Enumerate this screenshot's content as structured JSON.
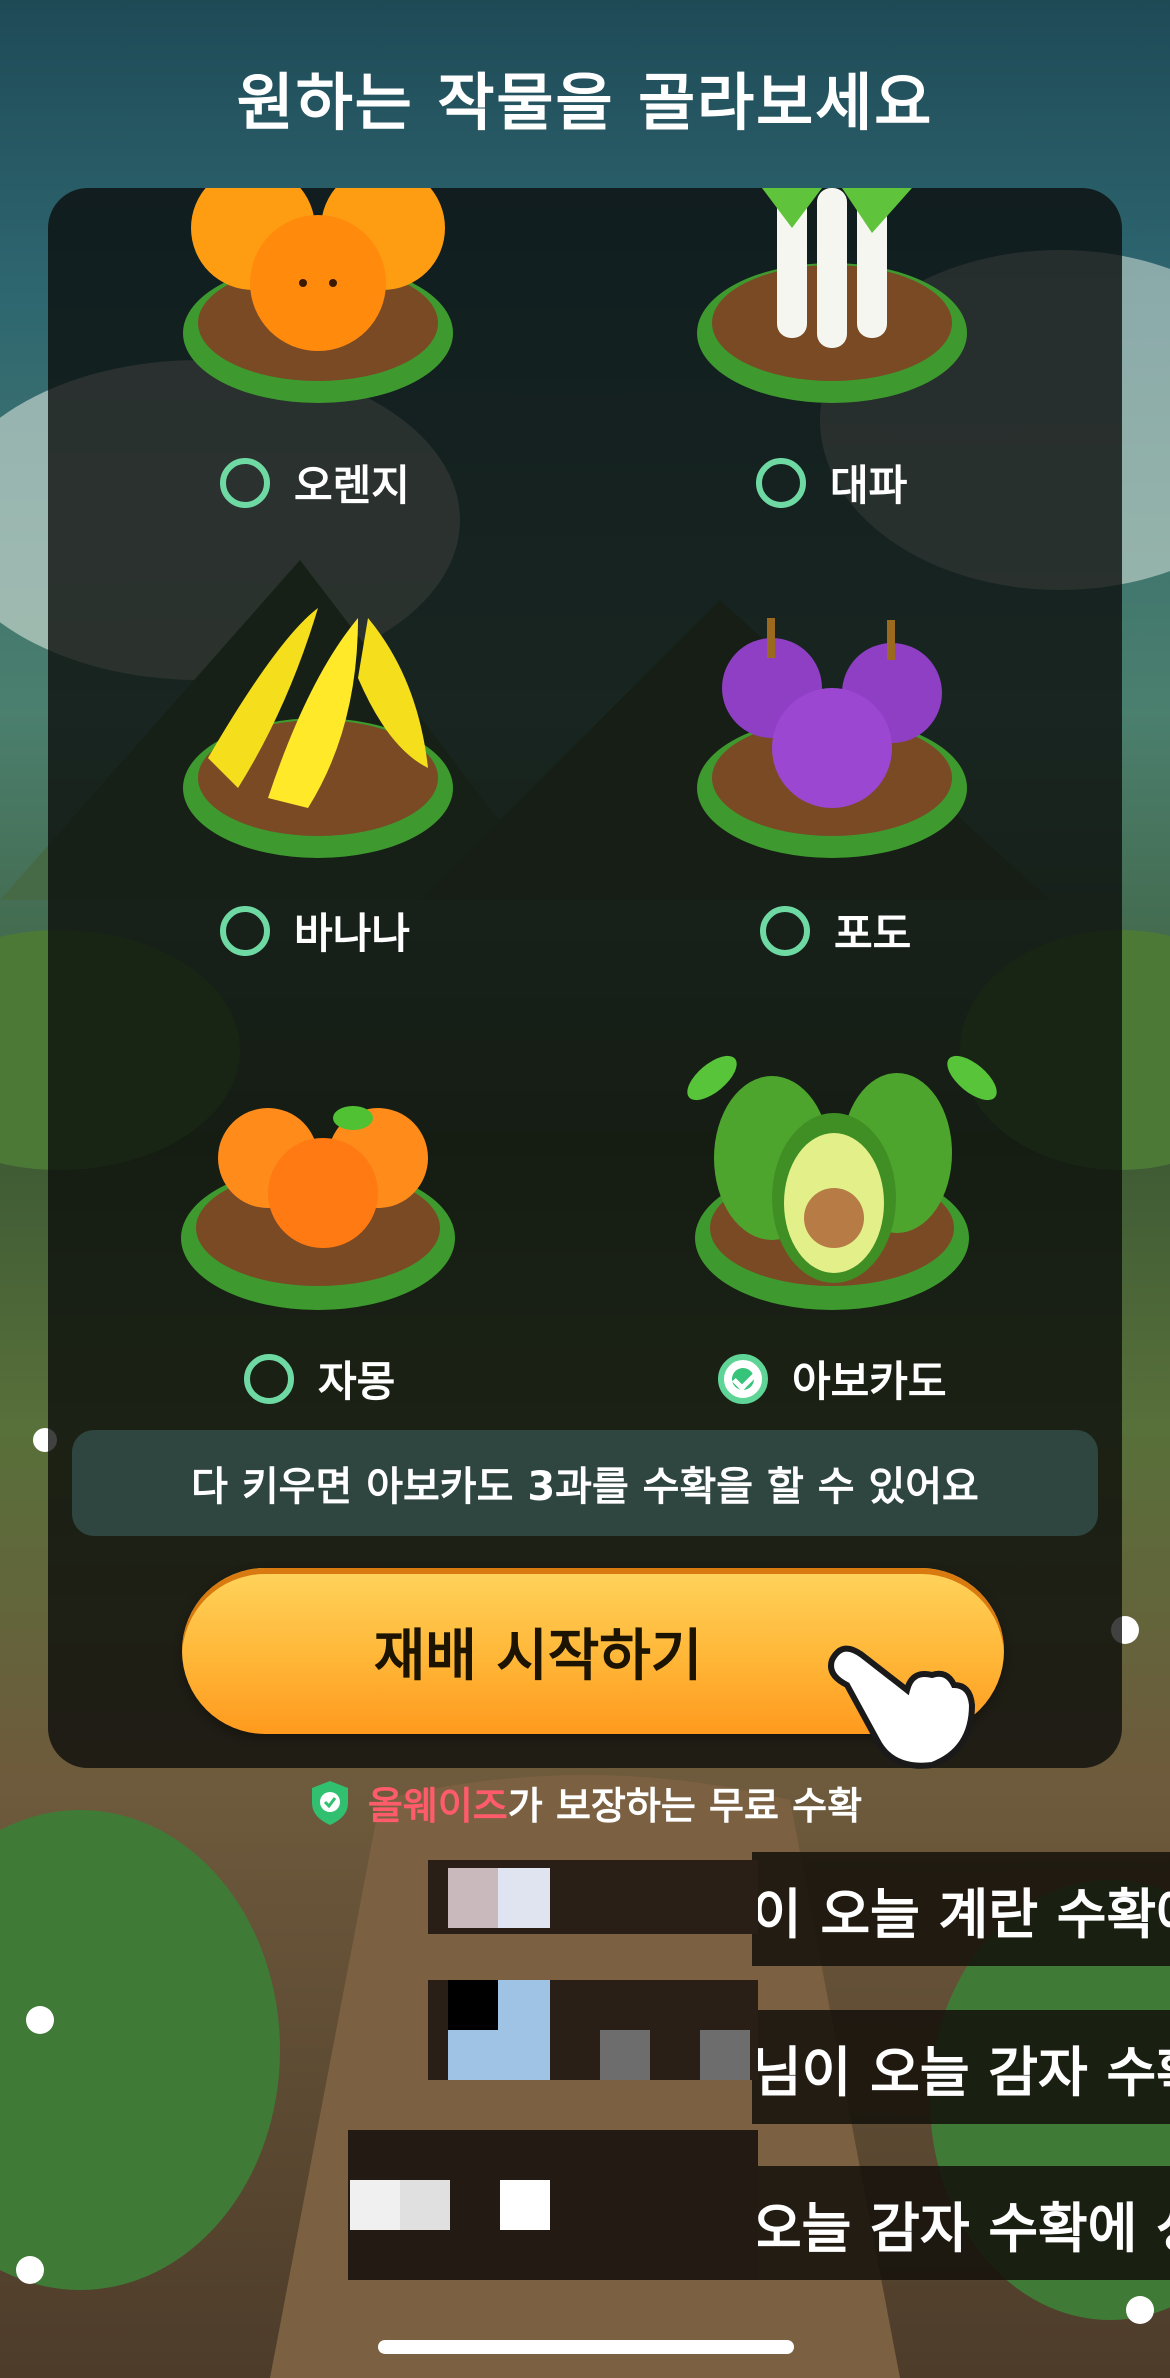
{
  "title": "원하는 작물을 골라보세요",
  "crops": [
    {
      "name": "오렌지",
      "selected": false
    },
    {
      "name": "대파",
      "selected": false
    },
    {
      "name": "바나나",
      "selected": false
    },
    {
      "name": "포도",
      "selected": false
    },
    {
      "name": "자몽",
      "selected": false
    },
    {
      "name": "아보카도",
      "selected": true
    }
  ],
  "info_text": "다 키우면 아보카도 3과를 수확을 할 수 있어요",
  "start_button": "재배 시작하기",
  "guarantee": {
    "brand": "올웨이즈",
    "rest": "가 보장하는 무료 수확"
  },
  "ticker": [
    "이 오늘 계란 수확에",
    "님이 오늘 감자 수확에",
    "오늘 감자 수확에 성"
  ],
  "colors": {
    "accent": "#ffb637",
    "radio": "#6fd9a4",
    "brand": "#ff5b6b"
  }
}
